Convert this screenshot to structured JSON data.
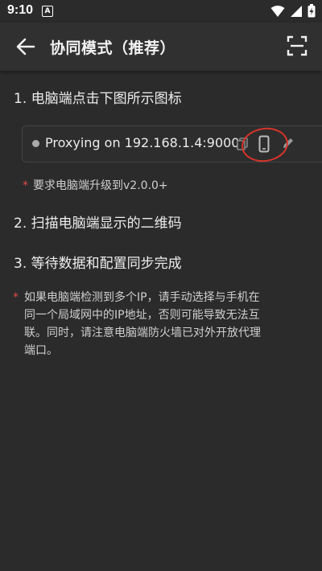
{
  "status_bar": {
    "time": "9:10",
    "notification_letter": "A"
  },
  "app_bar": {
    "title": "协同模式（推荐）"
  },
  "steps": [
    "1. 电脑端点击下图所示图标",
    "2. 扫描电脑端显示的二维码",
    "3. 等待数据和配置同步完成"
  ],
  "proxy_card": {
    "text": "Proxying on 192.168.1.4:9000"
  },
  "notes": {
    "version_star": "*",
    "version": "要求电脑端升级到v2.0.0+",
    "network_star": "*",
    "network_lines": [
      "如果电脑端检测到多个IP，请手动选择与手机在",
      "同一个局域网中的IP地址，否则可能导致无法互",
      "联。同时，请注意电脑端防火墙已对外开放代理",
      "端口。"
    ]
  },
  "colors": {
    "background": "#2b2b2b",
    "accent_red": "#d8342a"
  }
}
